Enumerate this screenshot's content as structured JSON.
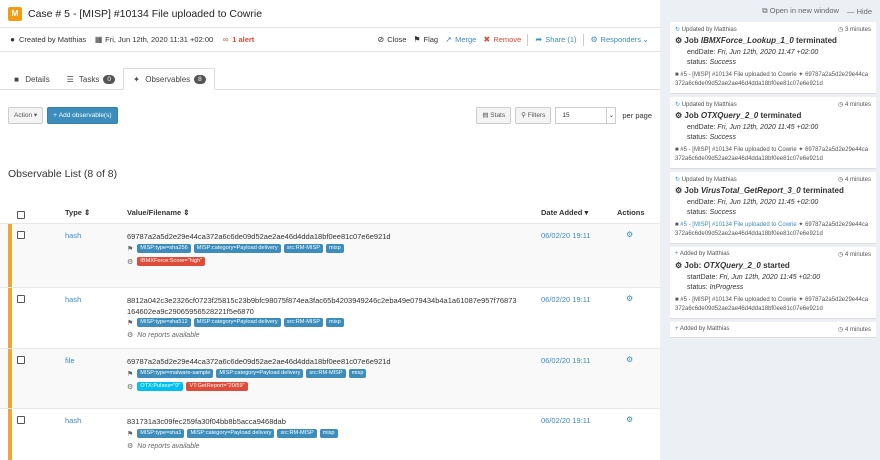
{
  "case": {
    "badge": "M",
    "title": "Case # 5 - [MISP] #10134 File uploaded to Cowrie",
    "created_by": "Created by Matthias",
    "date": "Fri, Jun 12th, 2020 11:31 +02:00",
    "alert": "1 alert",
    "actions": {
      "close": "Close",
      "flag": "Flag",
      "merge": "Merge",
      "remove": "Remove",
      "share": "Share (1)",
      "responders": "Responders"
    }
  },
  "tabs": [
    {
      "label": "Details"
    },
    {
      "label": "Tasks",
      "count": "0"
    },
    {
      "label": "Observables",
      "count": "8"
    }
  ],
  "toolbar": {
    "action": "Action",
    "add": "Add observable(s)",
    "stats": "Stats",
    "filters": "Filters",
    "per_page_value": "15",
    "per_page_label": "per page"
  },
  "list_title": "Observable List (8 of 8)",
  "columns": {
    "type": "Type",
    "value": "Value/Filename",
    "date": "Date Added",
    "actions": "Actions"
  },
  "rows": [
    {
      "type": "hash",
      "value": "69787a2a5d2e29e44ca372a6c6de09d52ae2ae46d4dda18bf0ee81c07e6e921d",
      "value2": "",
      "date": "06/02/20 19:11",
      "tags": [
        "MISP:type=sha256",
        "MISP:category=Payload delivery",
        "src:RM-MISP",
        "misp"
      ],
      "reports": [
        {
          "label": "IBMXForce:Score=\"high\"",
          "color": "red"
        }
      ],
      "noreport": ""
    },
    {
      "type": "hash",
      "value": "8812a042c3e2326cf0723f25815c23b9bfc98075f874ea3fac65b4203949246c2eba49e079434b4a1a61087e957f76873",
      "value2": "164602ea9c29065956528221f5e6870",
      "date": "06/02/20 19:11",
      "tags": [
        "MISP:type=sha512",
        "MISP:category=Payload delivery",
        "src:RM-MISP",
        "misp"
      ],
      "reports": [],
      "noreport": "No reports available"
    },
    {
      "type": "file",
      "value": "69787a2a5d2e29e44ca372a6c6de09d52ae2ae46d4dda18bf0ee81c07e6e921d",
      "value2": "",
      "date": "06/02/20 19:11",
      "tags": [
        "MISP:type=malware-sample",
        "MISP:category=Payload delivery",
        "src:RM-MISP",
        "misp"
      ],
      "reports": [
        {
          "label": "OTX:Pulses=\"0\"",
          "color": "cyan"
        },
        {
          "label": "VT:GetReport=\"20/59\"",
          "color": "red"
        }
      ],
      "noreport": ""
    },
    {
      "type": "hash",
      "value": "831731a3c09fec259fa30f04bb8b5acca9468dab",
      "value2": "",
      "date": "06/02/20 19:11",
      "tags": [
        "MISP:type=sha1",
        "MISP:category=Payload delivery",
        "src:RM-MISP",
        "misp"
      ],
      "reports": [],
      "noreport": "No reports available"
    }
  ],
  "sidebar": {
    "open_new": "Open in new window",
    "hide": "Hide",
    "cards": [
      {
        "who": "Updated by Matthias",
        "ago": "3 minutes",
        "prefix": "Job ",
        "job": "IBMXForce_Lookup_1_0",
        "suffix": " terminated",
        "date_label": "endDate:",
        "date": "Fri, Jun 12th, 2020 11:47 +02:00",
        "status_label": "status:",
        "status": "Success",
        "ref": "#5 - [MISP] #10134 File uploaded to Cowrie",
        "ref_link": false,
        "ref_tail": "69787a2a5d2e29e44ca372a6c6de09d52ae2ae46d4dda18bf0ee81c07e6e921d"
      },
      {
        "who": "Updated by Matthias",
        "ago": "4 minutes",
        "prefix": "Job ",
        "job": "OTXQuery_2_0",
        "suffix": " terminated",
        "date_label": "endDate:",
        "date": "Fri, Jun 12th, 2020 11:45 +02:00",
        "status_label": "status:",
        "status": "Success",
        "ref": "#5 - [MISP] #10134 File uploaded to Cowrie",
        "ref_link": false,
        "ref_tail": "69787a2a5d2e29e44ca372a6c6de09d52ae2ae46d4dda18bf0ee81c07e6e921d"
      },
      {
        "who": "Updated by Matthias",
        "ago": "4 minutes",
        "prefix": "Job ",
        "job": "VirusTotal_GetReport_3_0",
        "suffix": " terminated",
        "date_label": "endDate:",
        "date": "Fri, Jun 12th, 2020 11:45 +02:00",
        "status_label": "status:",
        "status": "Success",
        "ref": "#5 - [MISP] #10134 File uploaded to Cowrie",
        "ref_link": true,
        "ref_tail": "69787a2a5d2e29e44ca372a6c6de09d52ae2ae46d4dda18bf0ee81c07e6e921d"
      },
      {
        "who": "Added by Matthias",
        "ago": "4 minutes",
        "prefix": "Job: ",
        "job": "OTXQuery_2_0",
        "suffix": " started",
        "date_label": "startDate:",
        "date": "Fri, Jun 12th, 2020 11:45 +02:00",
        "status_label": "status:",
        "status": "InProgress",
        "ref": "#5 - [MISP] #10134 File uploaded to Cowrie",
        "ref_link": false,
        "ref_tail": "69787a2a5d2e29e44ca372a6c6de09d52ae2ae46d4dda18bf0ee81c07e6e921d"
      },
      {
        "who": "Added by Matthias",
        "ago": "4 minutes"
      }
    ]
  },
  "colors": {
    "accent": "#3c8dbc",
    "danger": "#dd4b39",
    "info": "#00c0ef",
    "row_marker": "#f0a534"
  }
}
